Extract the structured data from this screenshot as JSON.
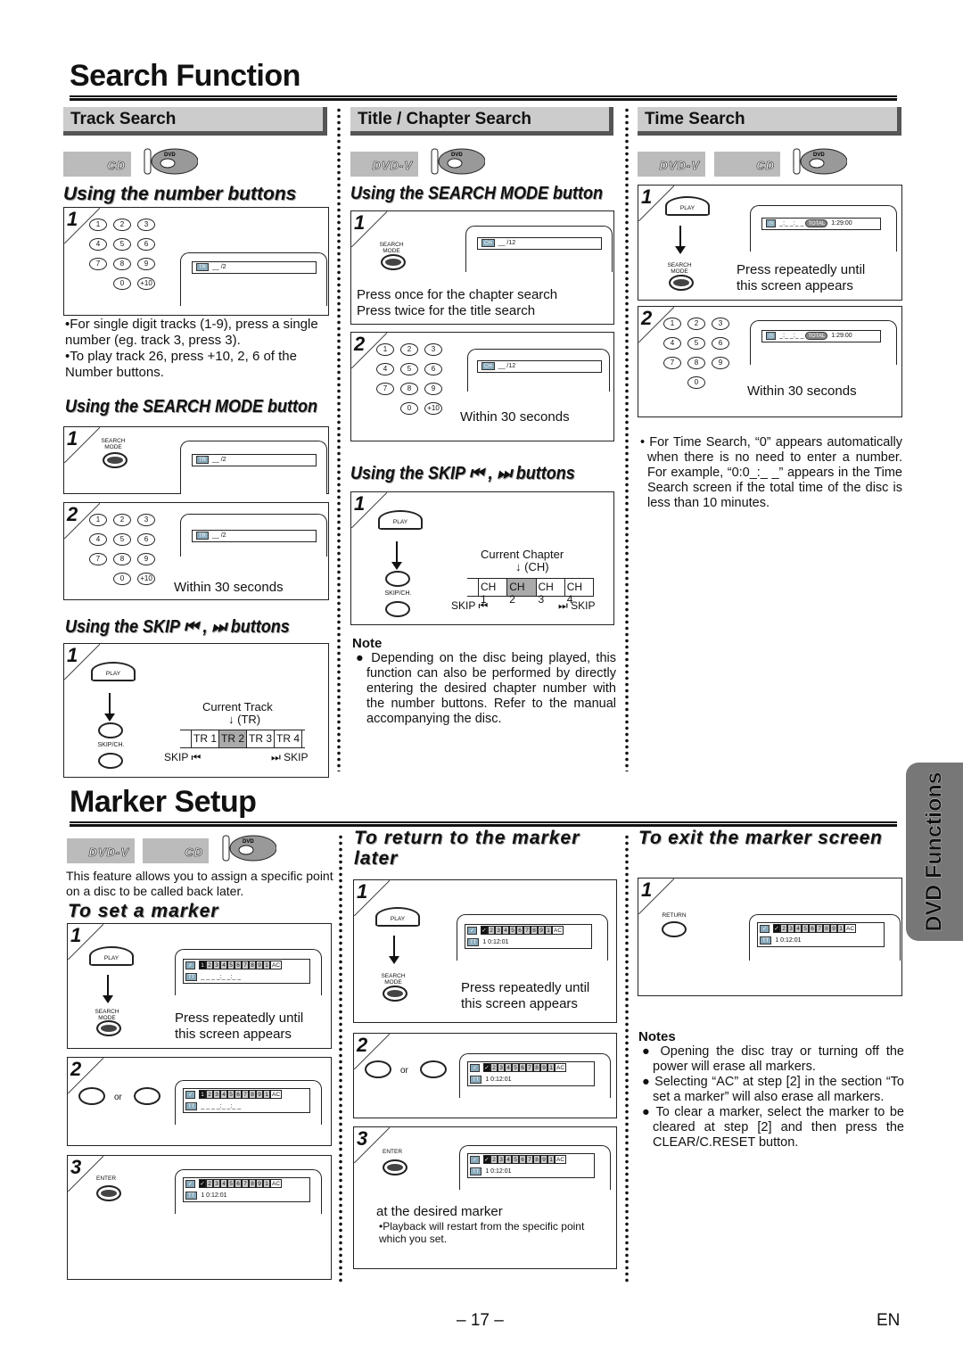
{
  "page": {
    "title_search": "Search Function",
    "title_marker": "Marker Setup",
    "page_number": "– 17 –",
    "language": "EN",
    "side_tab": "DVD Functions"
  },
  "colors": {
    "section_bg": "#cccccc",
    "section_shadow": "#555555",
    "highlight": "#aaaaaa",
    "tab_bg": "#777777"
  },
  "track_search": {
    "heading": "Track Search",
    "discs": [
      "CD"
    ],
    "number_buttons": {
      "title": "Using the number buttons",
      "step1": {
        "step": "1",
        "osd": "__ /2",
        "osd_badge": "TR"
      },
      "bullets": [
        "•For single digit tracks (1-9), press a single number (eg. track 3, press 3).",
        "•To play track 26, press +10, 2, 6 of the Number buttons."
      ]
    },
    "search_mode": {
      "title": "Using the SEARCH MODE button",
      "step1": {
        "step": "1",
        "button": "SEARCH MODE",
        "osd": "__ /2",
        "osd_badge": "TR"
      },
      "step2": {
        "step": "2",
        "osd": "__ /2",
        "osd_badge": "TR",
        "caption": "Within 30 seconds"
      }
    },
    "skip": {
      "title": "Using the SKIP ⏮ , ⏭ buttons",
      "step1": {
        "step": "1",
        "play": "PLAY",
        "skip_button": "SKIP/CH.",
        "current_label": "Current Track",
        "current_abbr": "(TR)",
        "items": [
          "TR 1",
          "TR 2",
          "TR 3",
          "TR 4"
        ],
        "current_index": 1,
        "skip_left": "SKIP ⏮",
        "skip_right": "⏭ SKIP"
      }
    }
  },
  "chapter_search": {
    "heading": "Title / Chapter Search",
    "discs": [
      "DVD-V"
    ],
    "search_mode": {
      "title": "Using the SEARCH MODE button",
      "step1": {
        "step": "1",
        "button": "SEARCH MODE",
        "osd": "__ /12",
        "osd_badge": "CH",
        "caption_lines": [
          "Press once for the chapter search",
          "Press twice for the title search"
        ]
      },
      "step2": {
        "step": "2",
        "osd": "__ /12",
        "osd_badge": "CH",
        "caption": "Within 30 seconds"
      }
    },
    "skip": {
      "title": "Using the SKIP ⏮ , ⏭ buttons",
      "step1": {
        "step": "1",
        "play": "PLAY",
        "skip_button": "SKIP/CH.",
        "current_label": "Current Chapter",
        "current_abbr": "(CH)",
        "items": [
          "CH 1",
          "CH 2",
          "CH 3",
          "CH 4"
        ],
        "current_index": 1,
        "skip_left": "SKIP ⏮",
        "skip_right": "⏭ SKIP"
      }
    },
    "note": {
      "heading": "Note",
      "text": "Depending on the disc being played, this function can also be performed by directly entering the desired chapter number with the number buttons. Refer to the manual accompanying the disc."
    }
  },
  "time_search": {
    "heading": "Time Search",
    "discs": [
      "DVD-V",
      "CD"
    ],
    "step1": {
      "step": "1",
      "play": "PLAY",
      "button": "SEARCH MODE",
      "osd_time": "_:_ _:_ _",
      "osd_total_label": "TOTAL",
      "osd_total": "1:29:00",
      "caption_lines": [
        "Press repeatedly until",
        "this screen appears"
      ]
    },
    "step2": {
      "step": "2",
      "osd_time": "_:_ _:_ _",
      "osd_total_label": "TOTAL",
      "osd_total": "1:29:00",
      "caption": "Within 30 seconds"
    },
    "bullet": "• For Time Search, “0” appears automatically when there is no need to enter a number. For example, “0:0_:_ _” appears in the Time Search screen if the total time of the disc is less than 10 minutes."
  },
  "marker": {
    "discs": [
      "DVD-V",
      "CD"
    ],
    "intro": "This feature allows you to assign a specific point on a disc to be called back later.",
    "markers": [
      "1",
      "2",
      "3",
      "4",
      "5",
      "6",
      "7",
      "8",
      "9",
      "10"
    ],
    "clear_all": "AC",
    "tt_badge": "TT",
    "set": {
      "title": "To set a marker",
      "step1": {
        "step": "1",
        "play": "PLAY",
        "button": "SEARCH MODE",
        "selected": "1",
        "tt_value": "_ _  _ _:_ _:_ _",
        "caption_lines": [
          "Press repeatedly until",
          "this screen appears"
        ]
      },
      "step2": {
        "step": "2",
        "or": "or",
        "selected": "1",
        "tt_value": "_ _  _ _:_ _:_ _"
      },
      "step3": {
        "step": "3",
        "button": "ENTER",
        "selected": "✓",
        "tt_value": "1  0:12:01"
      }
    },
    "return": {
      "title_lines": [
        "To return to the marker",
        "later"
      ],
      "step1": {
        "step": "1",
        "play": "PLAY",
        "button": "SEARCH MODE",
        "selected": "✓",
        "tt_value": "1  0:12:01",
        "caption_lines": [
          "Press repeatedly until",
          "this screen appears"
        ]
      },
      "step2": {
        "step": "2",
        "or": "or",
        "selected": "✓",
        "tt_value": "1  0:12:01"
      },
      "step3": {
        "step": "3",
        "button": "ENTER",
        "selected": "✓",
        "tt_value": "1  0:12:01",
        "caption": "at the desired marker",
        "sub": "•Playback will restart from the specific point which you set."
      }
    },
    "exit": {
      "title": "To exit the marker screen",
      "step1": {
        "step": "1",
        "button": "RETURN",
        "selected": "✓",
        "tt_value": "1  0:12:01"
      },
      "notes_heading": "Notes",
      "notes": [
        "Opening the disc tray or turning off the power will erase all markers.",
        "Selecting “AC” at step [2] in the section “To set a marker” will also erase all markers.",
        "To clear a marker, select the marker to be cleared at step [2] and then press the CLEAR/C.RESET button."
      ]
    }
  }
}
